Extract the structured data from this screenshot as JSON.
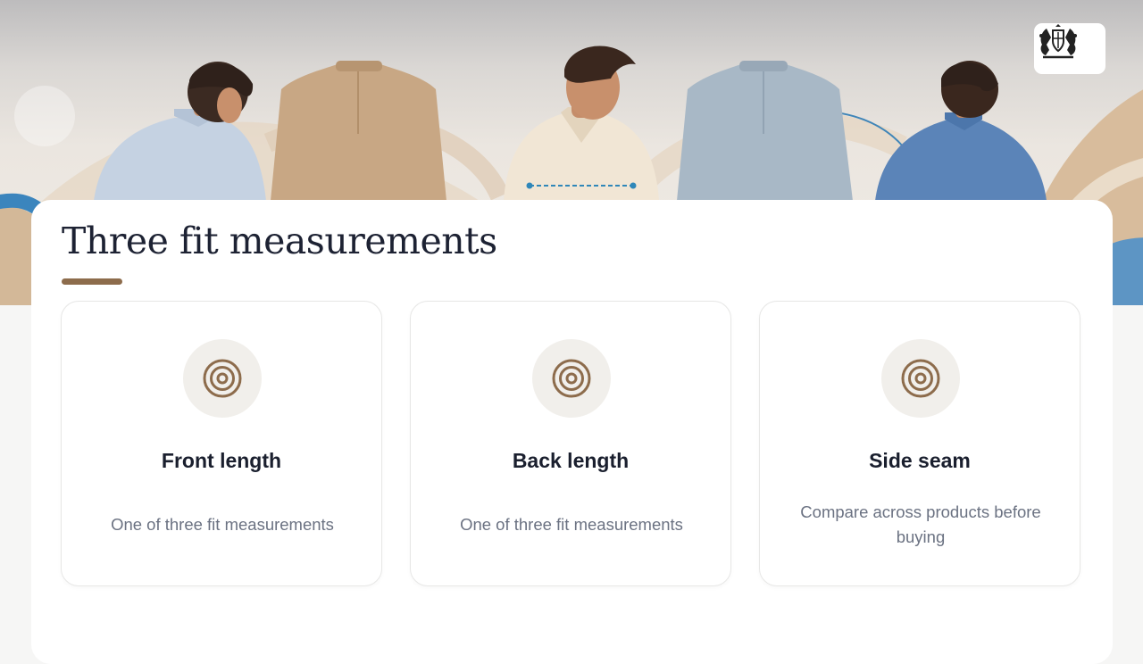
{
  "logo": {
    "icon": "heraldic-crest-logo"
  },
  "section": {
    "title": "Three fit measurements"
  },
  "cards": [
    {
      "icon": "target-icon",
      "title": "Front length",
      "description": "One of three fit measurements"
    },
    {
      "icon": "target-icon",
      "title": "Back length",
      "description": "One of three fit measurements"
    },
    {
      "icon": "target-icon",
      "title": "Side seam",
      "description": "Compare across products before buying"
    }
  ],
  "colors": {
    "accent": "#8d6c4c",
    "icon_bg": "#f1efeb",
    "title_text": "#1d2233",
    "body_text": "#6b7282",
    "measure_line": "#2f87b9"
  }
}
